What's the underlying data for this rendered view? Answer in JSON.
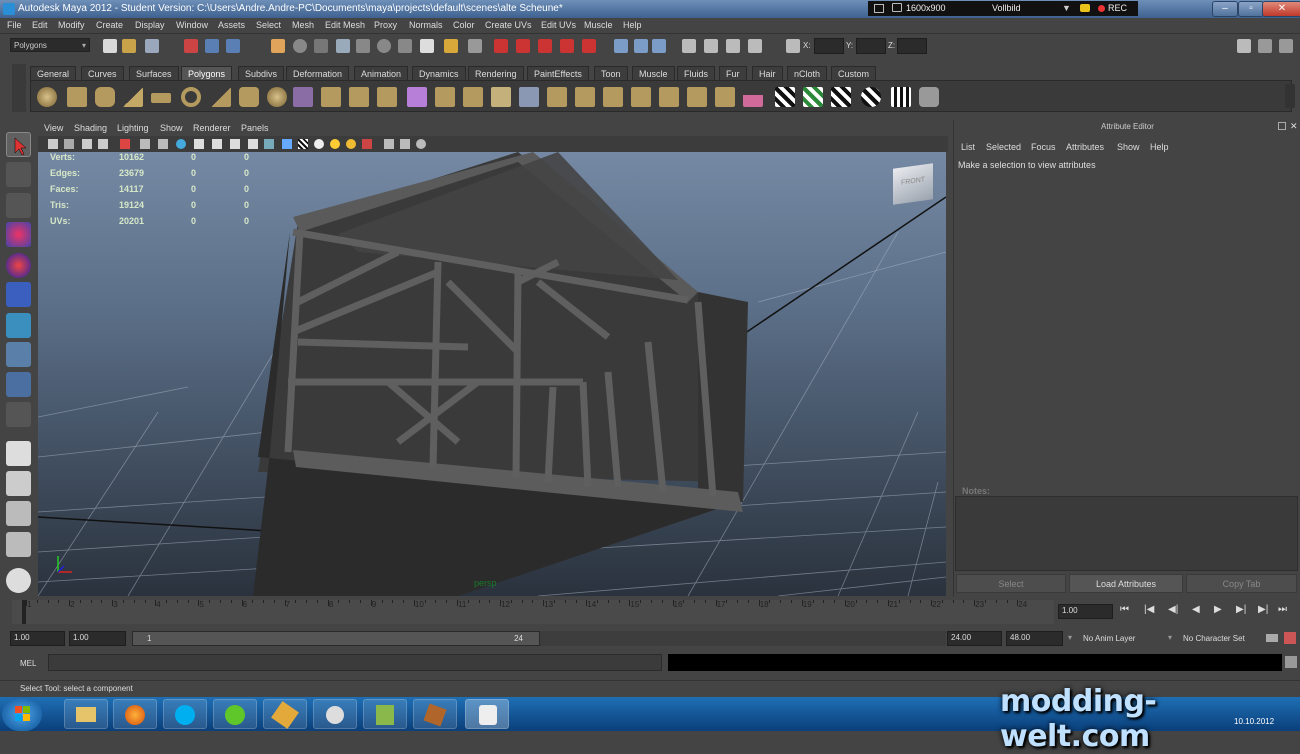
{
  "window": {
    "title": "Autodesk Maya 2012 - Student Version: C:\\Users\\Andre.Andre-PC\\Documents\\maya\\projects\\default\\scenes\\alte Scheune*"
  },
  "recorder": {
    "resolution": "1600x900",
    "mode": "Vollbild",
    "rec": "REC"
  },
  "menubar": [
    "File",
    "Edit",
    "Modify",
    "Create",
    "Display",
    "Window",
    "Assets",
    "Select",
    "Mesh",
    "Edit Mesh",
    "Proxy",
    "Normals",
    "Color",
    "Create UVs",
    "Edit UVs",
    "Muscle",
    "Help"
  ],
  "statusline": {
    "menuset": "Polygons",
    "x_label": "X:",
    "y_label": "Y:",
    "z_label": "Z:"
  },
  "shelf_tabs": [
    "General",
    "Curves",
    "Surfaces",
    "Polygons",
    "Subdivs",
    "Deformation",
    "Animation",
    "Dynamics",
    "Rendering",
    "PaintEffects",
    "Toon",
    "Muscle",
    "Fluids",
    "Fur",
    "Hair",
    "nCloth",
    "Custom"
  ],
  "active_shelf_tab": "Polygons",
  "viewport": {
    "menu": [
      "View",
      "Shading",
      "Lighting",
      "Show",
      "Renderer",
      "Panels"
    ],
    "camera": "persp",
    "viewcube_label": "FRONT",
    "hud": [
      {
        "label": "Verts:",
        "v1": "10162",
        "v2": "0",
        "v3": "0"
      },
      {
        "label": "Edges:",
        "v1": "23679",
        "v2": "0",
        "v3": "0"
      },
      {
        "label": "Faces:",
        "v1": "14117",
        "v2": "0",
        "v3": "0"
      },
      {
        "label": "Tris:",
        "v1": "19124",
        "v2": "0",
        "v3": "0"
      },
      {
        "label": "UVs:",
        "v1": "20201",
        "v2": "0",
        "v3": "0"
      }
    ]
  },
  "attribute_editor": {
    "header": "Attribute Editor",
    "menu": [
      "List",
      "Selected",
      "Focus",
      "Attributes",
      "Show",
      "Help"
    ],
    "message": "Make a selection to view attributes",
    "notes_label": "Notes:",
    "buttons": {
      "select": "Select",
      "load": "Load Attributes",
      "copy": "Copy Tab"
    }
  },
  "timeline": {
    "ticks": [
      "1",
      "2",
      "3",
      "4",
      "5",
      "6",
      "7",
      "8",
      "9",
      "10",
      "11",
      "12",
      "13",
      "14",
      "15",
      "16",
      "17",
      "18",
      "19",
      "20",
      "21",
      "22",
      "23",
      "24"
    ],
    "current_time": "1.00"
  },
  "range": {
    "start": "1.00",
    "playback_start": "1.00",
    "range_left": "1",
    "range_right": "24",
    "playback_end": "24.00",
    "end": "48.00",
    "anim_layer": "No Anim Layer",
    "character_set": "No Character Set"
  },
  "command": {
    "label": "MEL"
  },
  "help_line": "Select Tool: select a component",
  "taskbar": {
    "clock_date": "10.10.2012"
  },
  "watermark": "modding-welt.com"
}
